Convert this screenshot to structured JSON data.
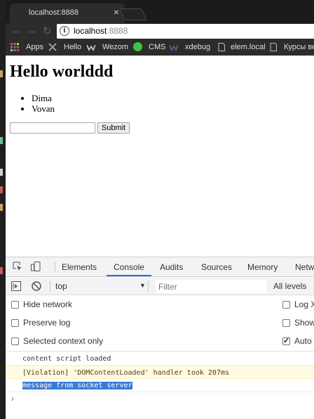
{
  "browser": {
    "tab_title": "localhost:8888",
    "tab_close": "×",
    "url_host": "localhost",
    "url_port": ":8888",
    "bookmarks": [
      "Apps",
      "Hello",
      "Wezom",
      "CMS",
      "xdebug",
      "elem.local",
      "Курсы ве"
    ]
  },
  "page": {
    "heading": "Hello worlddd",
    "list_items": [
      "Dima",
      "Vovan"
    ],
    "submit_label": "Submit"
  },
  "devtools": {
    "tabs": [
      "Elements",
      "Console",
      "Audits",
      "Sources",
      "Memory",
      "Netw"
    ],
    "active_tab": "Console",
    "context": "top",
    "filter_placeholder": "Filter",
    "levels": "All levels",
    "settings_left": [
      "Hide network",
      "Preserve log",
      "Selected context only"
    ],
    "settings_right": [
      {
        "label": "Log X",
        "checked": false
      },
      {
        "label": "Show",
        "checked": false
      },
      {
        "label": "Auto",
        "checked": true
      }
    ],
    "messages": [
      {
        "text": "content script loaded",
        "type": "log"
      },
      {
        "text": "[Violation] 'DOMContentLoaded' handler took 207ms",
        "type": "violation"
      },
      {
        "text": "message from socket server",
        "type": "selected"
      }
    ],
    "prompt": "›"
  },
  "colors": {
    "accent": "#1a73e8",
    "selection": "#3a7bd5",
    "warning_bg": "#fffbe5"
  }
}
